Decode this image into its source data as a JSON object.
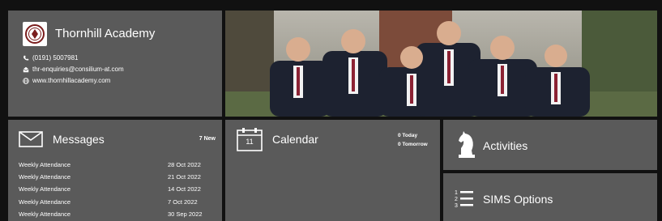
{
  "school": {
    "name": "Thornhill Academy",
    "phone": "(0191) 5007981",
    "email": "thr-enquiries@consilium-at.com",
    "website": "www.thornhillacademy.com"
  },
  "messages": {
    "title": "Messages",
    "badge": "7 New",
    "items": [
      {
        "subject": "Weekly Attendance",
        "date": "28 Oct 2022"
      },
      {
        "subject": "Weekly Attendance",
        "date": "21 Oct 2022"
      },
      {
        "subject": "Weekly Attendance",
        "date": "14 Oct 2022"
      },
      {
        "subject": "Weekly Attendance",
        "date": "7 Oct 2022"
      },
      {
        "subject": "Weekly Attendance",
        "date": "30 Sep 2022"
      }
    ]
  },
  "calendar": {
    "title": "Calendar",
    "icon_day": "11",
    "today": "0 Today",
    "tomorrow": "0 Tomorrow"
  },
  "activities": {
    "title": "Activities"
  },
  "sims": {
    "title": "SIMS Options"
  },
  "icons": {
    "phone": "phone-icon",
    "email": "email-icon",
    "web": "globe-icon",
    "messages": "envelope-icon",
    "calendar": "calendar-icon",
    "activities": "chess-knight-icon",
    "sims": "numbered-list-icon"
  }
}
